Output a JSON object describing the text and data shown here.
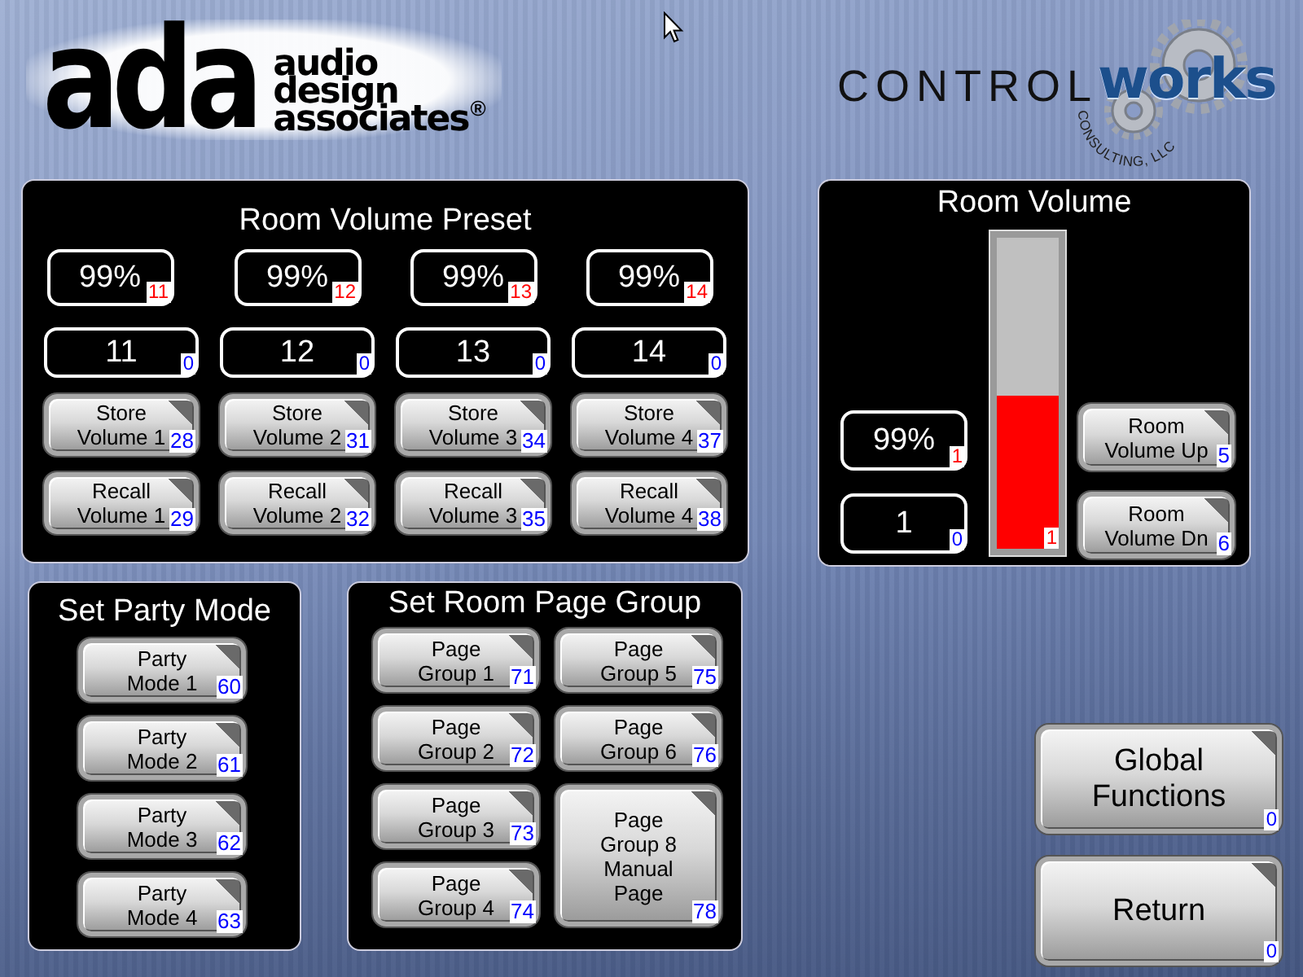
{
  "header": {
    "ada_logo": {
      "mark": "ada",
      "lines": [
        "audio",
        "design",
        "associates"
      ],
      "registered": "®"
    },
    "controlworks_logo": {
      "word": "CONTROL",
      "accent": "works",
      "tagline": "CONSULTING, LLC"
    }
  },
  "preset_panel": {
    "title": "Room Volume Preset",
    "columns": [
      {
        "percent": {
          "value": "99%",
          "join": {
            "text": "11",
            "color": "#ff0000"
          }
        },
        "number": {
          "value": "11",
          "join": {
            "text": "0",
            "color": "#0000ff"
          }
        },
        "buttons": [
          {
            "lines": [
              "Store",
              "Volume 1"
            ],
            "join": {
              "text": "28",
              "color": "#0000ff"
            }
          },
          {
            "lines": [
              "Recall",
              "Volume 1"
            ],
            "join": {
              "text": "29",
              "color": "#0000ff"
            }
          }
        ]
      },
      {
        "percent": {
          "value": "99%",
          "join": {
            "text": "12",
            "color": "#ff0000"
          }
        },
        "number": {
          "value": "12",
          "join": {
            "text": "0",
            "color": "#0000ff"
          }
        },
        "buttons": [
          {
            "lines": [
              "Store",
              "Volume 2"
            ],
            "join": {
              "text": "31",
              "color": "#0000ff"
            }
          },
          {
            "lines": [
              "Recall",
              "Volume 2"
            ],
            "join": {
              "text": "32",
              "color": "#0000ff"
            }
          }
        ]
      },
      {
        "percent": {
          "value": "99%",
          "join": {
            "text": "13",
            "color": "#ff0000"
          }
        },
        "number": {
          "value": "13",
          "join": {
            "text": "0",
            "color": "#0000ff"
          }
        },
        "buttons": [
          {
            "lines": [
              "Store",
              "Volume 3"
            ],
            "join": {
              "text": "34",
              "color": "#0000ff"
            }
          },
          {
            "lines": [
              "Recall",
              "Volume 3"
            ],
            "join": {
              "text": "35",
              "color": "#0000ff"
            }
          }
        ]
      },
      {
        "percent": {
          "value": "99%",
          "join": {
            "text": "14",
            "color": "#ff0000"
          }
        },
        "number": {
          "value": "14",
          "join": {
            "text": "0",
            "color": "#0000ff"
          }
        },
        "buttons": [
          {
            "lines": [
              "Store",
              "Volume 4"
            ],
            "join": {
              "text": "37",
              "color": "#0000ff"
            }
          },
          {
            "lines": [
              "Recall",
              "Volume 4"
            ],
            "join": {
              "text": "38",
              "color": "#0000ff"
            }
          }
        ]
      }
    ]
  },
  "room_volume_panel": {
    "title": "Room Volume",
    "percent": {
      "value": "99%",
      "join": {
        "text": "1",
        "color": "#ff0000"
      }
    },
    "number": {
      "value": "1",
      "join": {
        "text": "0",
        "color": "#0000ff"
      }
    },
    "gauge": {
      "level": 0.49,
      "join": {
        "text": "1",
        "color": "#ff0000"
      }
    },
    "buttons": [
      {
        "lines": [
          "Room",
          "Volume Up"
        ],
        "join": {
          "text": "5",
          "color": "#0000ff"
        }
      },
      {
        "lines": [
          "Room",
          "Volume Dn"
        ],
        "join": {
          "text": "6",
          "color": "#0000ff"
        }
      }
    ]
  },
  "party_panel": {
    "title": "Set Party Mode",
    "buttons": [
      {
        "lines": [
          "Party",
          "Mode 1"
        ],
        "join": {
          "text": "60",
          "color": "#0000ff"
        }
      },
      {
        "lines": [
          "Party",
          "Mode 2"
        ],
        "join": {
          "text": "61",
          "color": "#0000ff"
        }
      },
      {
        "lines": [
          "Party",
          "Mode 3"
        ],
        "join": {
          "text": "62",
          "color": "#0000ff"
        }
      },
      {
        "lines": [
          "Party",
          "Mode 4"
        ],
        "join": {
          "text": "63",
          "color": "#0000ff"
        }
      }
    ]
  },
  "page_group_panel": {
    "title": "Set Room Page Group",
    "buttons": [
      {
        "kind": "standard",
        "lines": [
          "Page",
          "Group 1"
        ],
        "join": {
          "text": "71",
          "color": "#0000ff"
        }
      },
      {
        "kind": "standard",
        "lines": [
          "Page",
          "Group 2"
        ],
        "join": {
          "text": "72",
          "color": "#0000ff"
        }
      },
      {
        "kind": "standard",
        "lines": [
          "Page",
          "Group 3"
        ],
        "join": {
          "text": "73",
          "color": "#0000ff"
        }
      },
      {
        "kind": "standard",
        "lines": [
          "Page",
          "Group 4"
        ],
        "join": {
          "text": "74",
          "color": "#0000ff"
        }
      },
      {
        "kind": "standard",
        "lines": [
          "Page",
          "Group 5"
        ],
        "join": {
          "text": "75",
          "color": "#0000ff"
        }
      },
      {
        "kind": "standard",
        "lines": [
          "Page",
          "Group 6"
        ],
        "join": {
          "text": "76",
          "color": "#0000ff"
        }
      },
      {
        "kind": "tall",
        "lines": [
          "Page",
          "Group 8",
          "Manual",
          "Page"
        ],
        "join": {
          "text": "78",
          "color": "#0000ff"
        }
      }
    ]
  },
  "nav_buttons": [
    {
      "lines": [
        "Global",
        "Functions"
      ],
      "join": {
        "text": "0",
        "color": "#0000ff"
      }
    },
    {
      "lines": [
        "Return"
      ],
      "join": {
        "text": "0",
        "color": "#0000ff"
      }
    }
  ]
}
